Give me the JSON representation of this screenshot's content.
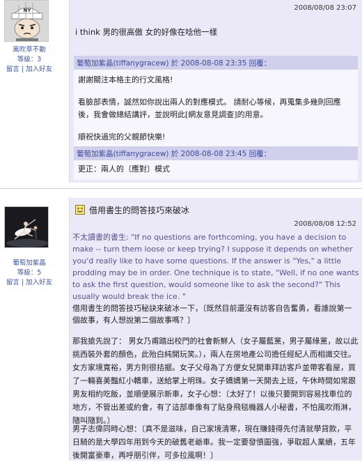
{
  "post1": {
    "user": {
      "name": "風吹草不動",
      "level": "等級：3",
      "message_link": "留言",
      "sep": "|",
      "add_friend_link": "加入好友"
    },
    "date": "2008/08/08 23:07",
    "message": "i think 男的很高傲  女的好像在唸他一樣",
    "replies": [
      {
        "header": "葡萄加紫晶(tiffanygracew) 於 2008-08-08 23:35 回覆：",
        "paragraphs": [
          "謝謝關注本格主的行文風格!",
          "看臉部表情，誠然如你說出兩人的對應模式。 請耐心等候，再蒐集多幾則回應後，我會做總結講評，並說明此[網友意見調查]的用意。",
          "順祝快過完的父親節快樂!"
        ]
      },
      {
        "header": "葡萄加紫晶(tiffanygracew) 於 2008-08-08 23:45 回覆：",
        "paragraphs": [
          "更正：兩人的〔應對〕模式"
        ]
      }
    ]
  },
  "post2": {
    "user": {
      "name": "葡萄加紫晶",
      "level": "等級：5",
      "message_link": "留言",
      "sep": "|",
      "add_friend_link": "加入好友"
    },
    "title": "借用書生的問答技巧來破冰",
    "date": "2008/08/08 12:52",
    "quote_en": "不太讀書的書生: \"If no questions are forthcoming, you have a decision to make -- turn them loose or keep trying? I suppose it depends on whether you'd really like to have some questions. If the answer is \"Yes,\" a little prodding may be in order. One technique is to state, \"Well, if no one wants to ask the first question, would someone like to ask the second?\" This usually would break the ice. \"",
    "quote_zh": "借用書生的問答技巧秘訣來破冰一下，〔既然目前還沒有訪客自告奮勇，看誰說第一個故事，有人想說第二個故事嗎？〕",
    "paragraphs": [
      "那我搶先說了： 男女乃甫踏出校門的社會新鮮人（女子屬藍黨，男子屬綠黨，故以此挑西裝外套的顏色，此殆白純開玩笑。），兩人在房地產公司擔任經紀人而相識交往。女方家境寬裕，男方則很拮据。女子父母為了方便女兒開車拜訪客戶並帶客看屋，買了一輛喜美豔紅小轎車，送給掌上明珠。女子嬌嬌第一天開去上班，午休時間如常跟男友相約吃飯，並順便展示新車，女子心想：〔太好了！以後只要開到容易找車位的地方，不管出差或約會，有了這部車像有了貼身飛毯機器人小秘書，不怕風吹雨淋，隨叫隨到。〕",
      "男子志偉同時心想：〔真不是滋味，自己家境清寒，現在賺錢得先付清就學貸款，平日騎的是大學四年用到今天的破舊老爺車。我一定要發憤圖強，爭取超人業績，五年後開富豪車，再呼朋引伴，可多拉風啊！〕"
    ]
  }
}
